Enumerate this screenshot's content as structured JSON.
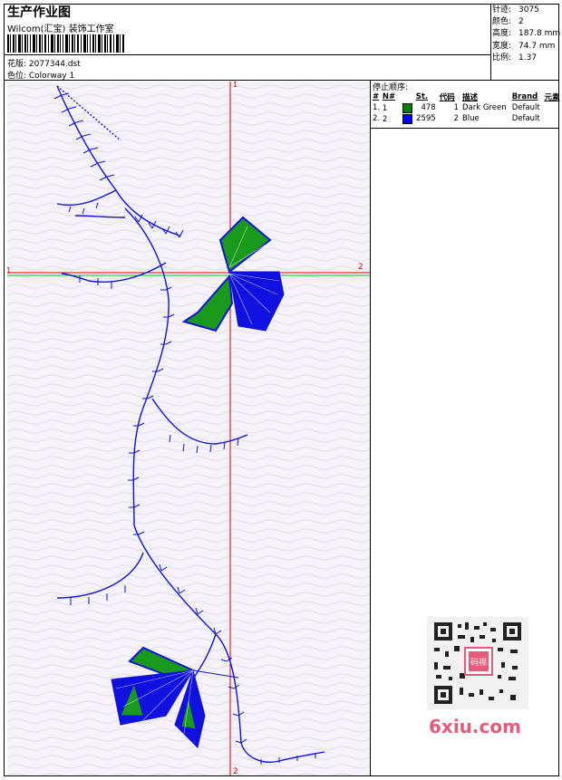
{
  "header": {
    "title": "生产作业图",
    "company": "Wilcom(汇宝) 装饰工作室",
    "design_label": "花版: 2077344.dst",
    "colorway_label": "色位: Colorway 1"
  },
  "stats": [
    {
      "label": "针迹:",
      "value": "3075"
    },
    {
      "label": "颜色:",
      "value": "2"
    },
    {
      "label": "高度:",
      "value": "187.8 mm"
    },
    {
      "label": "宽度:",
      "value": "74.7 mm"
    },
    {
      "label": "比例:",
      "value": "1.37"
    }
  ],
  "stop_sequence": {
    "title": "停止顺序:",
    "columns": [
      "#",
      "N#",
      "St.",
      "代码",
      "描述",
      "Brand",
      "元素"
    ],
    "rows": [
      {
        "index": "1.",
        "n": "1",
        "color": "#008000",
        "stitches": "478",
        "code": "1",
        "desc": "Dark Green",
        "brand": "Default",
        "element": ""
      },
      {
        "index": "2.",
        "n": "2",
        "color": "#0000ff",
        "stitches": "2595",
        "code": "2",
        "desc": "Blue",
        "brand": "Default",
        "element": ""
      }
    ]
  },
  "guides": {
    "v_top": "1",
    "v_bottom": "2",
    "h_left": "1",
    "h_right": "2"
  },
  "watermark": "6xiu.com",
  "qr_label": "码视"
}
